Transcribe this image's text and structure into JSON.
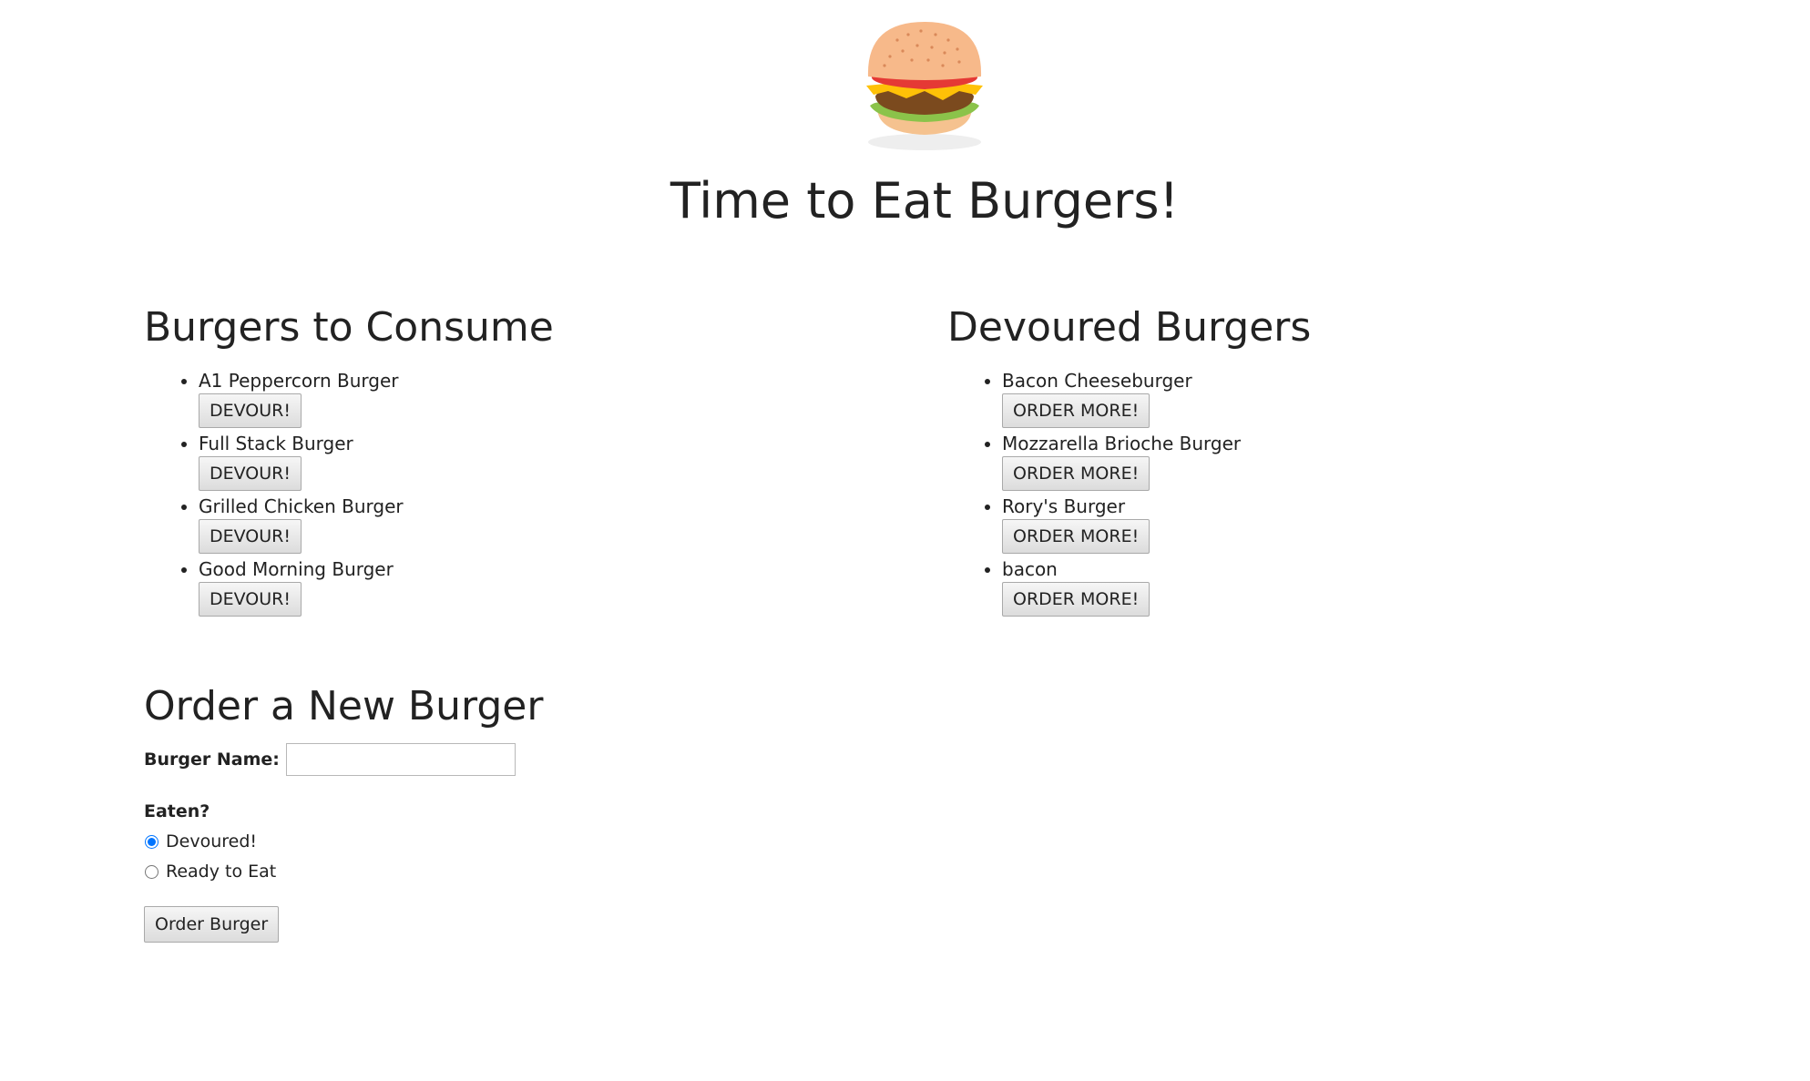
{
  "header": {
    "title": "Time to Eat Burgers!",
    "logo_icon": "burger-icon"
  },
  "to_consume": {
    "heading": "Burgers to Consume",
    "button_label": "DEVOUR!",
    "items": [
      {
        "name": "A1 Peppercorn Burger"
      },
      {
        "name": "Full Stack Burger"
      },
      {
        "name": "Grilled Chicken Burger"
      },
      {
        "name": "Good Morning Burger"
      }
    ]
  },
  "devoured": {
    "heading": "Devoured Burgers",
    "button_label": "ORDER MORE!",
    "items": [
      {
        "name": "Bacon Cheeseburger"
      },
      {
        "name": "Mozzarella Brioche Burger"
      },
      {
        "name": "Rory's Burger"
      },
      {
        "name": "bacon"
      }
    ]
  },
  "order_form": {
    "heading": "Order a New Burger",
    "name_label": "Burger Name:",
    "name_value": "",
    "eaten_label": "Eaten?",
    "options": [
      {
        "label": "Devoured!",
        "checked": true
      },
      {
        "label": "Ready to Eat",
        "checked": false
      }
    ],
    "submit_label": "Order Burger"
  }
}
